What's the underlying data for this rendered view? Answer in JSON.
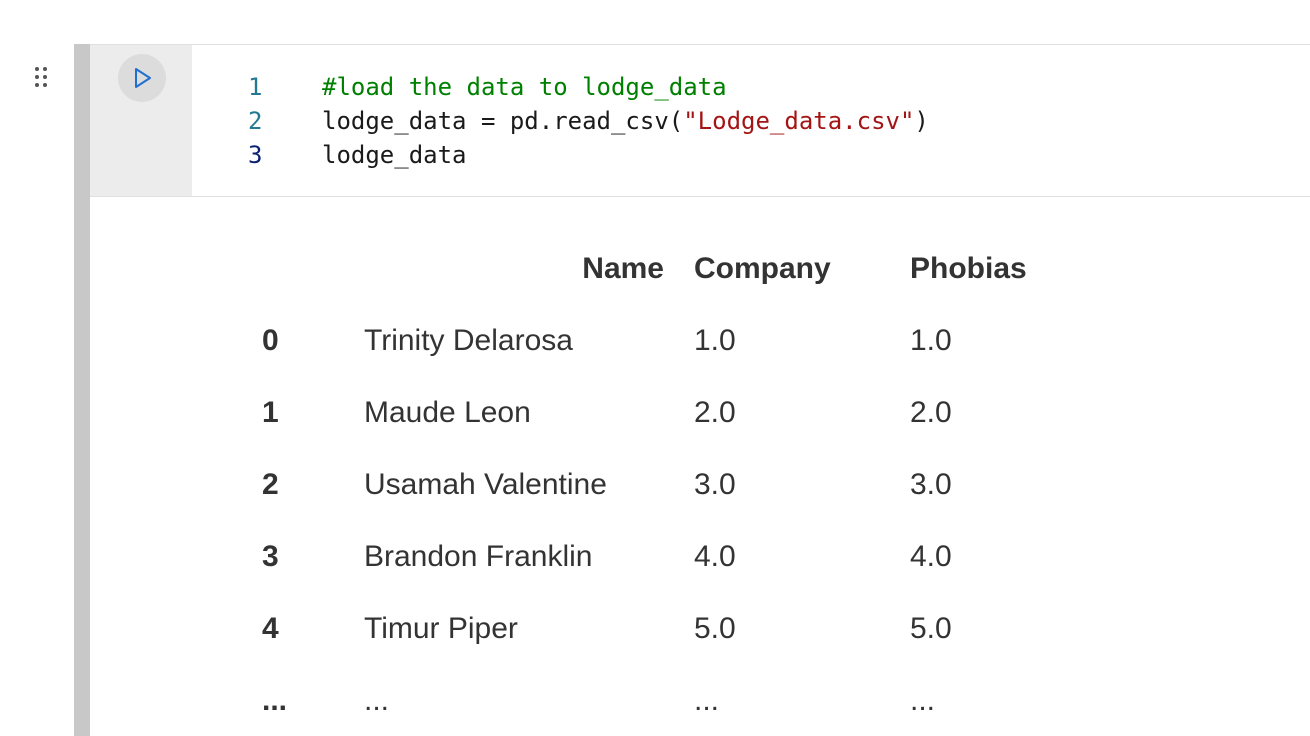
{
  "cell": {
    "run_button_icon": "play-icon",
    "drag_handle_icon": "drag-grip-icon",
    "code_lines": [
      {
        "number": "1",
        "tokens": [
          {
            "type": "comment",
            "text": "#load the data to lodge_data"
          }
        ]
      },
      {
        "number": "2",
        "tokens": [
          {
            "type": "plain",
            "text": "lodge_data = pd.read_csv("
          },
          {
            "type": "string",
            "text": "\"Lodge_data.csv\""
          },
          {
            "type": "plain",
            "text": ")"
          }
        ]
      },
      {
        "number": "3",
        "tokens": [
          {
            "type": "plain",
            "text": "lodge_data"
          }
        ]
      }
    ]
  },
  "output": {
    "columns": [
      "",
      "Name",
      "Company",
      "Phobias"
    ],
    "rows": [
      {
        "index": "0",
        "name": "Trinity Delarosa",
        "company": "1.0",
        "phobias": "1.0"
      },
      {
        "index": "1",
        "name": "Maude Leon",
        "company": "2.0",
        "phobias": "2.0"
      },
      {
        "index": "2",
        "name": "Usamah Valentine",
        "company": "3.0",
        "phobias": "3.0"
      },
      {
        "index": "3",
        "name": "Brandon Franklin",
        "company": "4.0",
        "phobias": "4.0"
      },
      {
        "index": "4",
        "name": "Timur Piper",
        "company": "5.0",
        "phobias": "5.0"
      },
      {
        "index": "...",
        "name": "...",
        "company": "...",
        "phobias": "..."
      }
    ]
  },
  "colors": {
    "comment": "#008000",
    "string": "#a31515",
    "line_number": "#237893",
    "cell_bar": "#c8c8c8",
    "run_gutter": "#ececec"
  }
}
